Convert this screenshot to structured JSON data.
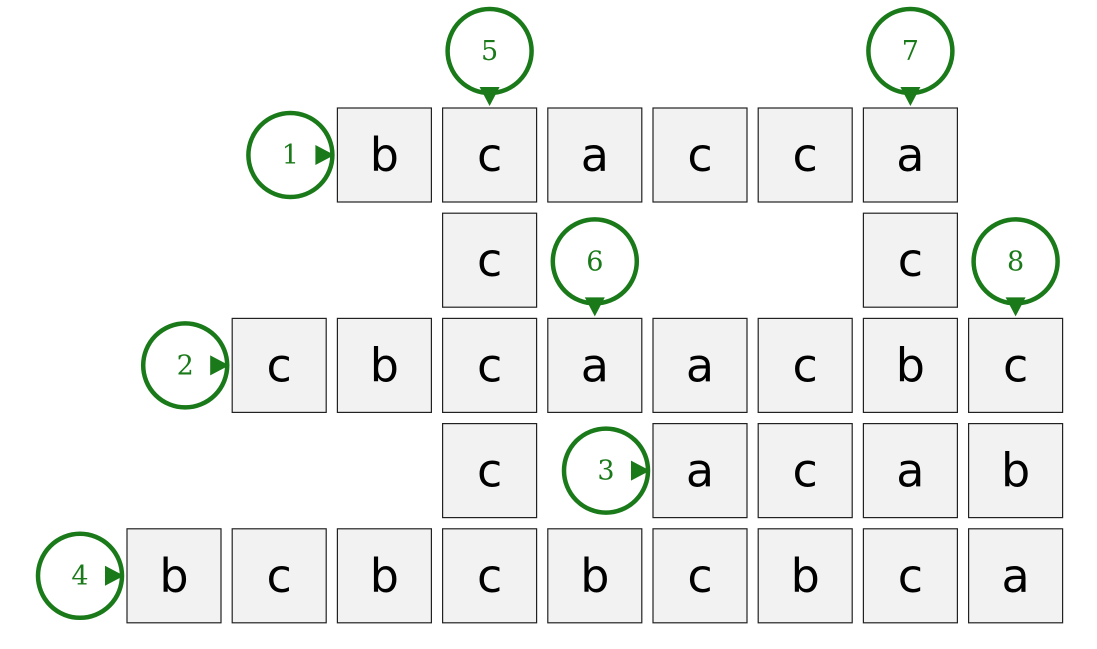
{
  "grid": {
    "cells": [
      {
        "row": 0,
        "col": 2,
        "letter": "b"
      },
      {
        "row": 0,
        "col": 3,
        "letter": "c"
      },
      {
        "row": 0,
        "col": 4,
        "letter": "a"
      },
      {
        "row": 0,
        "col": 5,
        "letter": "c"
      },
      {
        "row": 0,
        "col": 6,
        "letter": "c"
      },
      {
        "row": 0,
        "col": 7,
        "letter": "a"
      },
      {
        "row": 1,
        "col": 3,
        "letter": "c"
      },
      {
        "row": 1,
        "col": 7,
        "letter": "c"
      },
      {
        "row": 2,
        "col": 1,
        "letter": "c"
      },
      {
        "row": 2,
        "col": 2,
        "letter": "b"
      },
      {
        "row": 2,
        "col": 3,
        "letter": "c"
      },
      {
        "row": 2,
        "col": 4,
        "letter": "a"
      },
      {
        "row": 2,
        "col": 5,
        "letter": "a"
      },
      {
        "row": 2,
        "col": 6,
        "letter": "c"
      },
      {
        "row": 2,
        "col": 7,
        "letter": "b"
      },
      {
        "row": 2,
        "col": 8,
        "letter": "c"
      },
      {
        "row": 3,
        "col": 3,
        "letter": "c"
      },
      {
        "row": 3,
        "col": 5,
        "letter": "a"
      },
      {
        "row": 3,
        "col": 6,
        "letter": "c"
      },
      {
        "row": 3,
        "col": 7,
        "letter": "a"
      },
      {
        "row": 3,
        "col": 8,
        "letter": "b"
      },
      {
        "row": 4,
        "col": 0,
        "letter": "b"
      },
      {
        "row": 4,
        "col": 1,
        "letter": "c"
      },
      {
        "row": 4,
        "col": 2,
        "letter": "b"
      },
      {
        "row": 4,
        "col": 3,
        "letter": "c"
      },
      {
        "row": 4,
        "col": 4,
        "letter": "b"
      },
      {
        "row": 4,
        "col": 5,
        "letter": "c"
      },
      {
        "row": 4,
        "col": 6,
        "letter": "b"
      },
      {
        "row": 4,
        "col": 7,
        "letter": "c"
      },
      {
        "row": 4,
        "col": 8,
        "letter": "a"
      }
    ]
  },
  "clues": [
    {
      "number": "1",
      "direction": "across",
      "row": 0,
      "col": 2
    },
    {
      "number": "2",
      "direction": "across",
      "row": 2,
      "col": 1
    },
    {
      "number": "3",
      "direction": "across",
      "row": 3,
      "col": 5
    },
    {
      "number": "4",
      "direction": "across",
      "row": 4,
      "col": 0
    },
    {
      "number": "5",
      "direction": "down",
      "row": 0,
      "col": 3
    },
    {
      "number": "6",
      "direction": "down",
      "row": 2,
      "col": 4
    },
    {
      "number": "7",
      "direction": "down",
      "row": 0,
      "col": 7
    },
    {
      "number": "8",
      "direction": "down",
      "row": 2,
      "col": 8
    }
  ],
  "colors": {
    "clue": "#1a7a1a",
    "cell_fill": "#f2f2f2",
    "cell_border": "#222222",
    "letter": "#000000"
  }
}
